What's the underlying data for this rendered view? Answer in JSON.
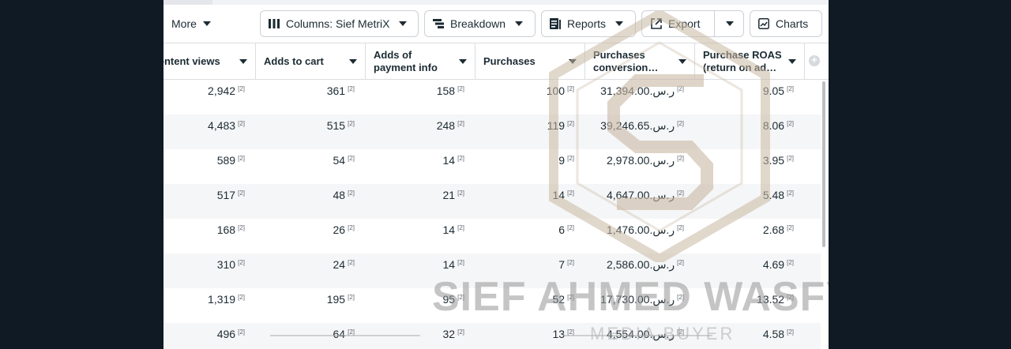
{
  "toolbar": {
    "more_label": "More",
    "columns_label": "Columns: Sief MetriX",
    "breakdown_label": "Breakdown",
    "reports_label": "Reports",
    "export_label": "Export",
    "charts_label": "Charts"
  },
  "table": {
    "headers": [
      "ontent views",
      "Adds to cart",
      "Adds of\npayment info",
      "Purchases",
      "Purchases\nconversion…",
      "Purchase ROAS\n(return on ad…"
    ],
    "rows": [
      [
        "2,942",
        "361",
        "158",
        "100",
        "ر.س.31,394.00",
        "9.05"
      ],
      [
        "4,483",
        "515",
        "248",
        "119",
        "ر.س.39,246.65",
        "8.06"
      ],
      [
        "589",
        "54",
        "14",
        "9",
        "ر.س.2,978.00",
        "3.95"
      ],
      [
        "517",
        "48",
        "21",
        "14",
        "ر.س.4,647.00",
        "5.48"
      ],
      [
        "168",
        "26",
        "14",
        "6",
        "ر.س.1,476.00",
        "2.68"
      ],
      [
        "310",
        "24",
        "14",
        "7",
        "ر.س.2,586.00",
        "4.69"
      ],
      [
        "1,319",
        "195",
        "95",
        "52",
        "ر.س.17,730.00",
        "13.52"
      ],
      [
        "496",
        "64",
        "32",
        "13",
        "ر.س.4,554.00",
        "4.58"
      ]
    ],
    "footnote_marker": "[2]"
  },
  "watermark": {
    "name": "SIEF AHMED WASFY",
    "subtitle": "MEDIA BUYER"
  },
  "colors": {
    "page_bg": "#0f1a24",
    "text": "#1c2b33",
    "border": "#ccd0d5",
    "row_alt": "#f5f6f7",
    "watermark": "#c9b8a3"
  }
}
